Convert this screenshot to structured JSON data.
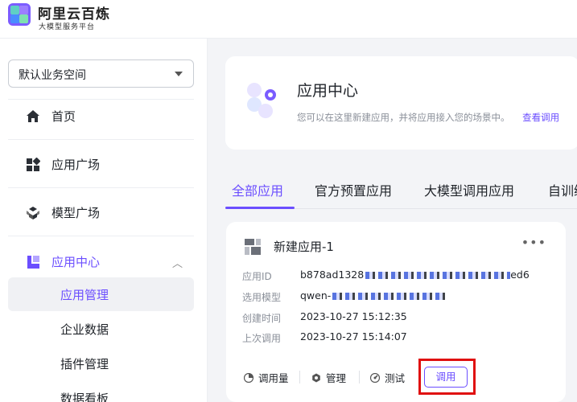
{
  "brand": {
    "title": "阿里云百炼",
    "subtitle": "大模型服务平台"
  },
  "sidebar": {
    "workspace": "默认业务空间",
    "items": [
      {
        "label": "首页",
        "icon": "home-icon"
      },
      {
        "label": "应用广场",
        "icon": "grid-icon"
      },
      {
        "label": "模型广场",
        "icon": "cubes-icon"
      },
      {
        "label": "应用中心",
        "icon": "app-center-icon",
        "expanded": true
      }
    ],
    "sub_items": [
      "应用管理",
      "企业数据",
      "插件管理",
      "数据看板"
    ],
    "selected_sub": "应用管理"
  },
  "banner": {
    "title": "应用中心",
    "description": "您可以在这里新建应用，并将应用接入您的场景中。",
    "link": "查看调用"
  },
  "tabs": [
    "全部应用",
    "官方预置应用",
    "大模型调用应用",
    "自训练"
  ],
  "card": {
    "title": "新建应用-1",
    "more": "•••",
    "rows": [
      {
        "label": "应用ID",
        "value": "b878ad1328",
        "tail": "ed6"
      },
      {
        "label": "选用模型",
        "value": "qwen-",
        "tail": ""
      },
      {
        "label": "创建时间",
        "value": "2023-10-27 15:12:35"
      },
      {
        "label": "上次调用",
        "value": "2023-10-27 15:14:07"
      }
    ],
    "actions": [
      {
        "label": "调用量",
        "icon": "pie-chart-icon"
      },
      {
        "label": "管理",
        "icon": "gear-icon"
      },
      {
        "label": "测试",
        "icon": "gauge-icon"
      }
    ],
    "call_button": "调用"
  },
  "colors": {
    "accent": "#6b4eff",
    "highlight": "#e01010"
  }
}
